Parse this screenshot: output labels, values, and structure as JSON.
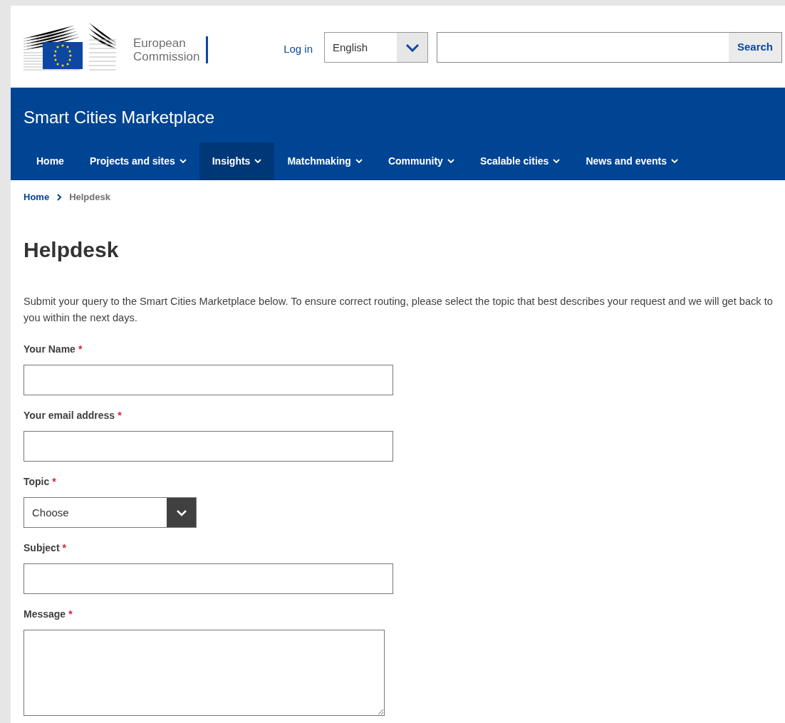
{
  "header": {
    "logo_text": [
      "European",
      "Commission"
    ],
    "login": "Log in",
    "language": {
      "value": "English"
    },
    "search": {
      "button": "Search"
    }
  },
  "site_title": "Smart Cities Marketplace",
  "nav": [
    {
      "label": "Home",
      "dropdown": false,
      "selected": false
    },
    {
      "label": "Projects and sites",
      "dropdown": true,
      "selected": false
    },
    {
      "label": "Insights",
      "dropdown": true,
      "selected": true
    },
    {
      "label": "Matchmaking",
      "dropdown": true,
      "selected": false
    },
    {
      "label": "Community",
      "dropdown": true,
      "selected": false
    },
    {
      "label": "Scalable cities",
      "dropdown": true,
      "selected": false
    },
    {
      "label": "News and events",
      "dropdown": true,
      "selected": false
    }
  ],
  "breadcrumb": [
    {
      "label": "Home",
      "kind": "link"
    },
    {
      "label": "Helpdesk",
      "kind": "current"
    }
  ],
  "heading": "Helpdesk",
  "intro": "Submit your query to the Smart Cities Marketplace below. To ensure correct routing, please select the topic that best describes your request and we will get back to you within the next days.",
  "fields": [
    {
      "label": "Your Name",
      "required_mark": "*",
      "kind": "text"
    },
    {
      "label": "Your email address",
      "required_mark": "*",
      "kind": "text"
    },
    {
      "label": "Topic",
      "required_mark": "*",
      "kind": "select",
      "value": "Choose"
    },
    {
      "label": "Subject",
      "required_mark": "*",
      "kind": "text"
    },
    {
      "label": "Message",
      "required_mark": "*",
      "kind": "textarea"
    }
  ]
}
